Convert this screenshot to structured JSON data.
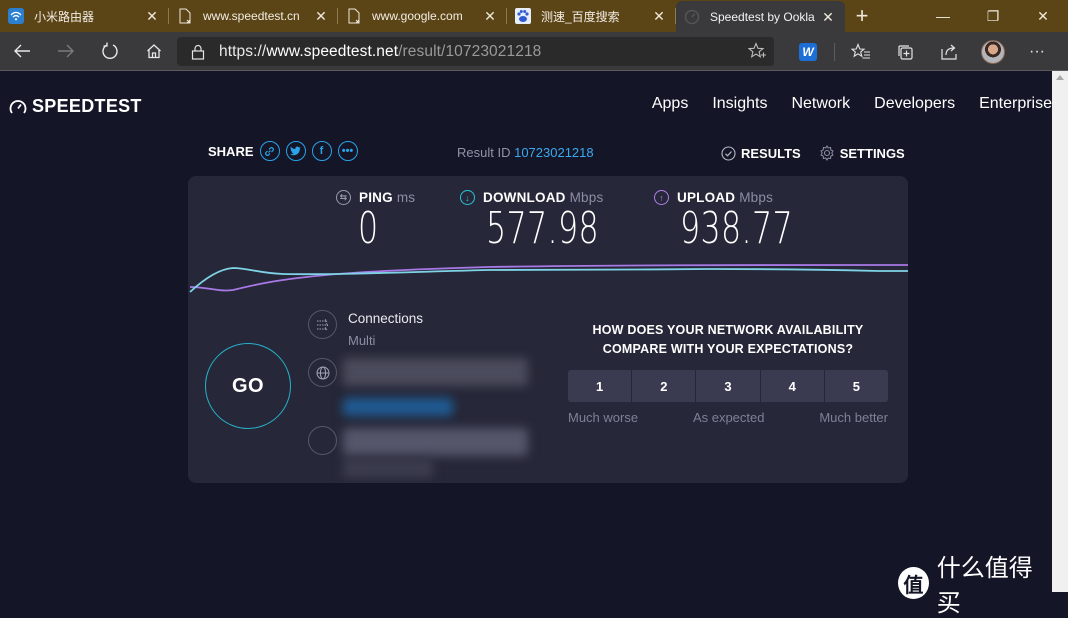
{
  "browser": {
    "tabs": [
      {
        "title": "小米路由器",
        "icon": "wifi-icon",
        "active": false
      },
      {
        "title": "www.speedtest.cn",
        "icon": "document-icon",
        "active": false
      },
      {
        "title": "www.google.com",
        "icon": "document-icon",
        "active": false
      },
      {
        "title": "测速_百度搜索",
        "icon": "baidu-paw-icon",
        "active": false
      },
      {
        "title": "Speedtest by Ookla",
        "icon": "speedtest-icon",
        "active": true
      }
    ],
    "close_glyph": "✕",
    "new_tab_glyph": "+",
    "window_controls": {
      "minimize": "—",
      "maximize": "❐",
      "close": "✕"
    },
    "address": {
      "scheme": "https://",
      "host": "www.speedtest.net",
      "path": "/result/10723021218"
    },
    "extension_label": "W",
    "more_glyph": "···"
  },
  "site": {
    "logo_text": "SPEEDTEST",
    "nav": [
      "Apps",
      "Insights",
      "Network",
      "Developers",
      "Enterprise"
    ],
    "share_label": "SHARE",
    "share_icons": [
      "link-icon",
      "twitter-icon",
      "facebook-icon",
      "more-icon"
    ],
    "result_id_label": "Result ID",
    "result_id": "10723021218",
    "results_label": "RESULTS",
    "settings_label": "SETTINGS"
  },
  "metrics": {
    "ping": {
      "label": "PING",
      "unit": "ms",
      "value": "0",
      "color": "#9a9cae"
    },
    "download": {
      "label": "DOWNLOAD",
      "unit": "Mbps",
      "value": "577.98",
      "color": "#26c6da"
    },
    "upload": {
      "label": "UPLOAD",
      "unit": "Mbps",
      "value": "938.77",
      "color": "#b37feb"
    }
  },
  "graph": {
    "download_color": "#7fd3e6",
    "upload_color": "#a779e6"
  },
  "go_label": "GO",
  "connections": {
    "title": "Connections",
    "value": "Multi"
  },
  "survey": {
    "question_line1": "HOW DOES YOUR NETWORK AVAILABILITY",
    "question_line2": "COMPARE WITH YOUR EXPECTATIONS?",
    "options": [
      "1",
      "2",
      "3",
      "4",
      "5"
    ],
    "low_label": "Much worse",
    "mid_label": "As expected",
    "high_label": "Much better"
  },
  "watermark": {
    "badge": "值",
    "text": "什么值得买"
  }
}
